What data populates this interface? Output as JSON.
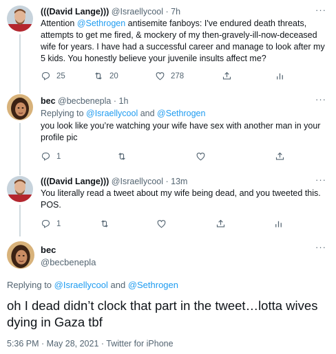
{
  "tweets": [
    {
      "name": "(((David Lange)))",
      "handle": "@Israellycool",
      "sep": "·",
      "time": "7h",
      "body_pre": "Attention ",
      "body_link": "@Sethrogen",
      "body_post": " antisemite fanboys: I've endured death threats, attempts to get me fired, & mockery of my then-gravely-ill-now-deceased wife for years. I have had a successful career and manage to look after my 5 kids. You honestly believe your juvenile insults affect me?",
      "replies": "25",
      "retweets": "20",
      "likes": "278"
    },
    {
      "name": "bec",
      "handle": "@becbenepla",
      "sep": "·",
      "time": "1h",
      "replying_prefix": "Replying to ",
      "replying_user1": "@Israellycool",
      "replying_and": " and ",
      "replying_user2": "@Sethrogen",
      "body": "you look like you’re watching your wife have sex with another man in your profile pic",
      "replies": "1"
    },
    {
      "name": "(((David Lange)))",
      "handle": "@Israellycool",
      "sep": "·",
      "time": "13m",
      "body": "You literally read a tweet about my wife being dead, and you tweeted this. POS.",
      "replies": "1"
    }
  ],
  "main_tweet": {
    "name": "bec",
    "handle": "@becbenepla",
    "replying_prefix": "Replying to ",
    "replying_user1": "@Israellycool",
    "replying_and": " and ",
    "replying_user2": "@Sethrogen",
    "body": "oh I dead didn’t clock that part in the tweet…lotta wives dying in Gaza tbf",
    "meta": "5:36 PM · May 28, 2021 · Twitter for iPhone"
  },
  "more_label": "···",
  "icons": {
    "reply": "reply-icon",
    "retweet": "retweet-icon",
    "like": "heart-icon",
    "share": "share-icon",
    "analytics": "analytics-icon"
  },
  "colors": {
    "link": "#1d9bf0",
    "secondary_text": "#536471",
    "text": "#0f1419"
  }
}
